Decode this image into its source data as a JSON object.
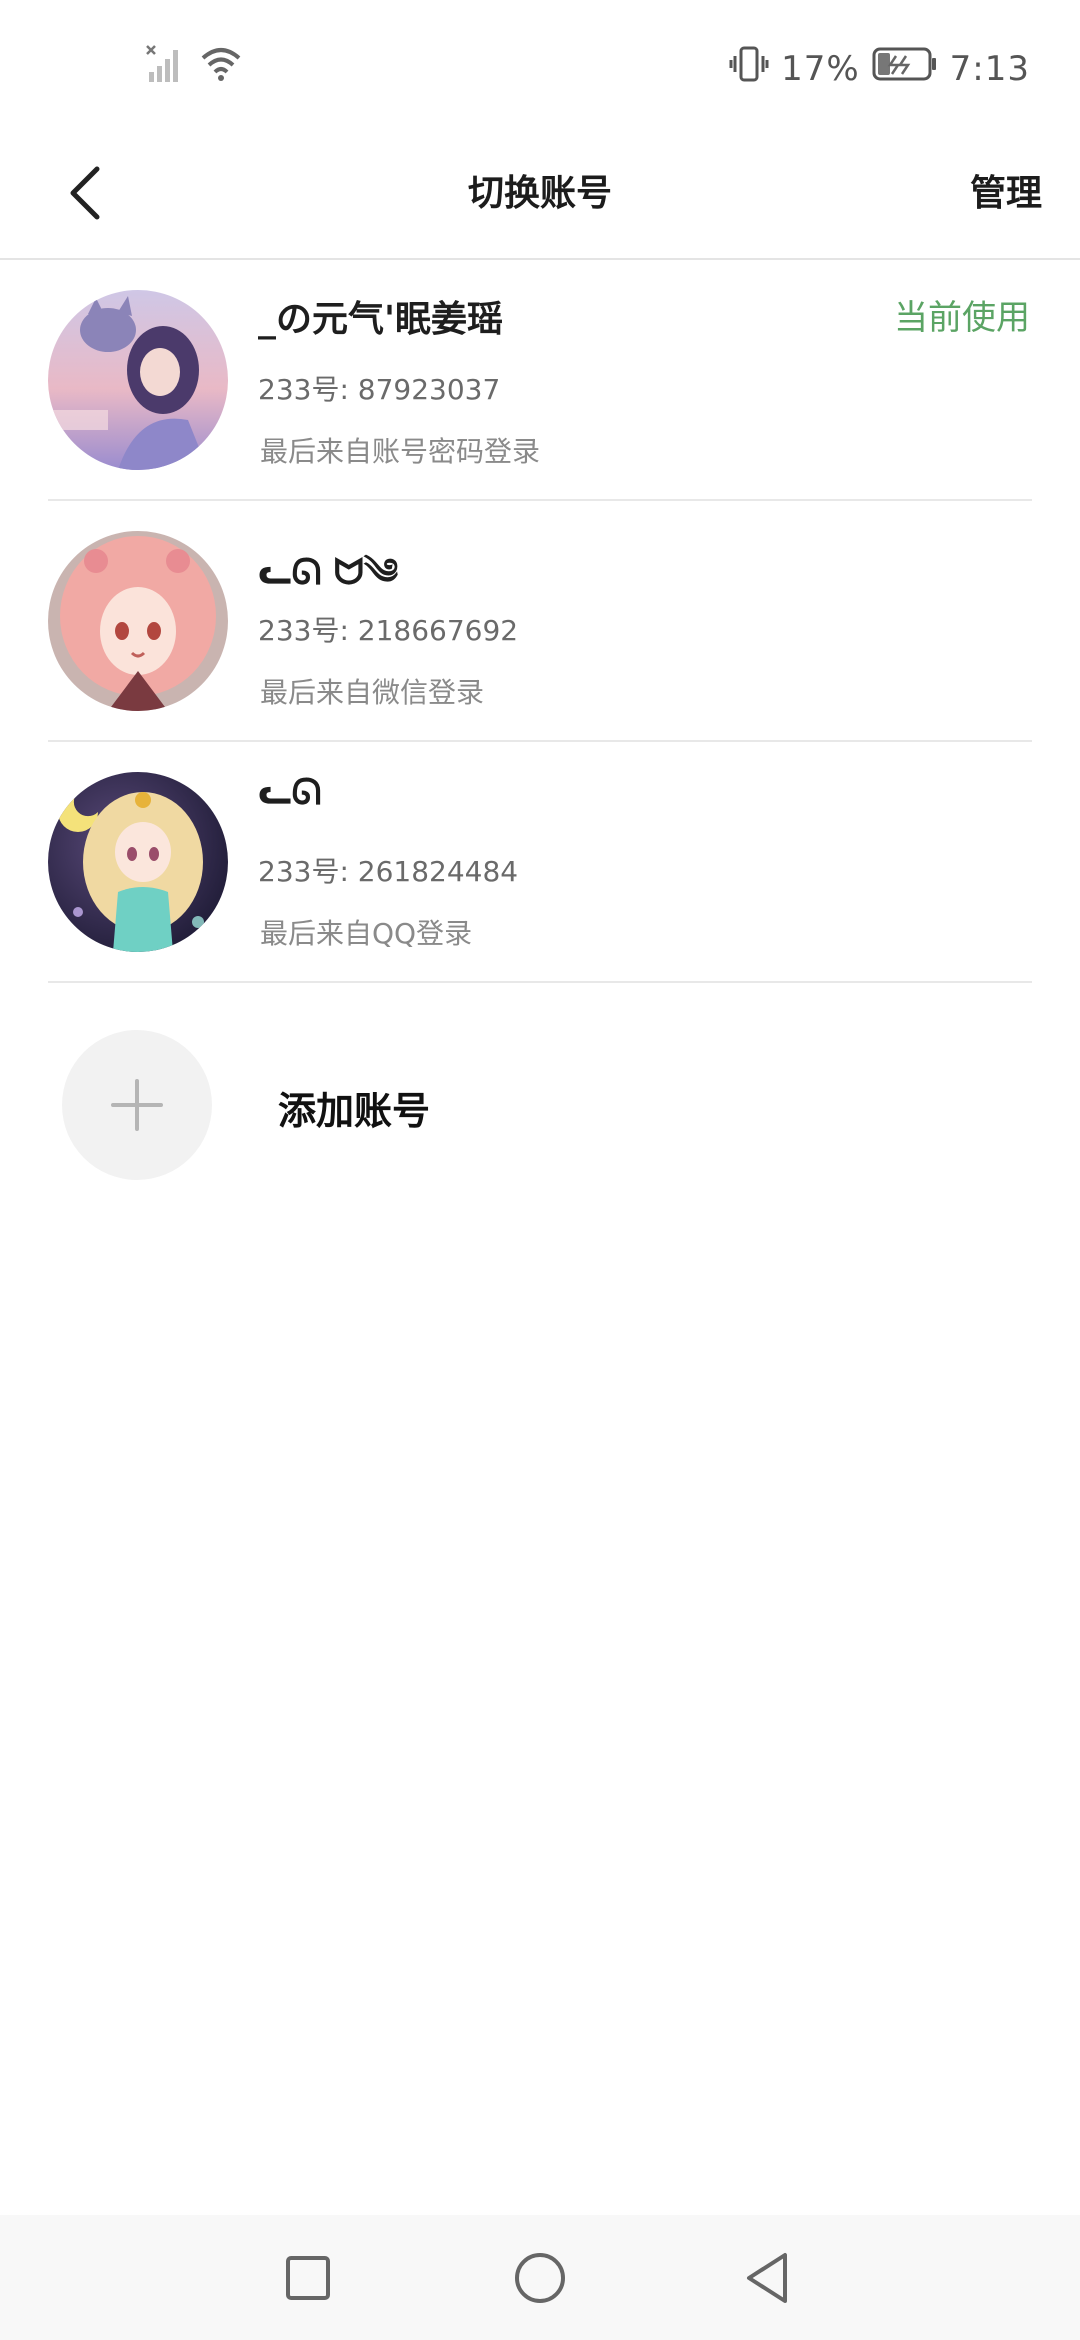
{
  "status_bar": {
    "battery_percent": "17%",
    "time": "7:13",
    "icons": [
      "signal-icon",
      "wifi-icon",
      "vibrate-icon",
      "battery-icon"
    ]
  },
  "header": {
    "title": "切换账号",
    "manage_label": "管理",
    "back_icon": "back-arrow-icon"
  },
  "accounts": [
    {
      "name": "_の元气'眠姜瑶",
      "id_line": "233号: 87923037",
      "login_source": "最后来自账号密码登录",
      "current_label": "当前使用"
    },
    {
      "name": "ᓚᘏ  ᗢ༄",
      "id_line": "233号: 218667692",
      "login_source": "最后来自微信登录"
    },
    {
      "name": "ᓚᘏ",
      "id_line": "233号: 261824484",
      "login_source": "最后来自QQ登录"
    }
  ],
  "add_account": {
    "label": "添加账号",
    "icon": "plus-icon"
  },
  "nav_bar": {
    "icons": [
      "recent-apps-icon",
      "home-icon",
      "back-icon"
    ]
  },
  "colors": {
    "accent_green": "#5ba464",
    "divider": "#e8e8e8",
    "secondary_text": "#8a8a8a"
  }
}
